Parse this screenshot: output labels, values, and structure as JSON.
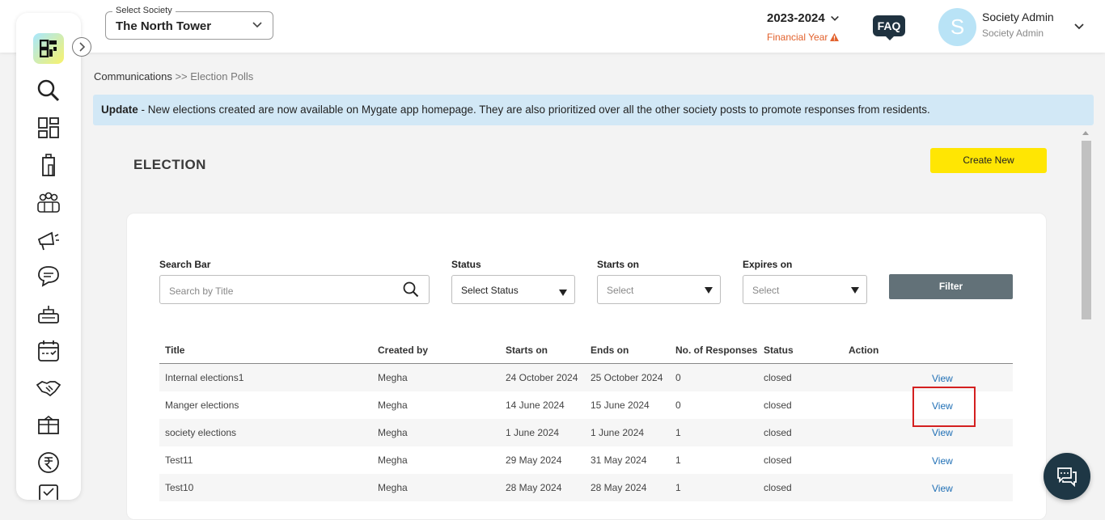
{
  "header": {
    "society_select_label": "Select Society",
    "society_value": "The North Tower",
    "financial_year": "2023-2024",
    "financial_year_label": "Financial Year",
    "faq_label": "FAQ",
    "avatar_initial": "S",
    "user_name": "Society Admin",
    "user_role": "Society Admin"
  },
  "sidebar": {
    "items": [
      "search-icon",
      "dashboard-icon",
      "building-icon",
      "residents-icon",
      "notices-icon",
      "communications-icon",
      "amenities-icon",
      "calendar-icon",
      "helpdesk-icon",
      "parcel-icon",
      "accounts-icon",
      "checklist-icon"
    ],
    "active": "communications-icon"
  },
  "breadcrumb": {
    "parent": "Communications",
    "separator": ">>",
    "current": "Election Polls"
  },
  "banner": {
    "strong": "Update",
    "text": " - New elections created are now available on Mygate app homepage. They are also prioritized over all the other society posts to promote responses from residents."
  },
  "main": {
    "title": "ELECTION",
    "create_button": "Create New"
  },
  "filters": {
    "search_label": "Search Bar",
    "search_placeholder": "Search by Title",
    "status_label": "Status",
    "status_value": "Select Status",
    "starts_label": "Starts on",
    "starts_value": "Select",
    "expires_label": "Expires on",
    "expires_value": "Select",
    "filter_button": "Filter"
  },
  "table": {
    "headers": [
      "Title",
      "Created by",
      "Starts on",
      "Ends on",
      "No. of Responses",
      "Status",
      "Action"
    ],
    "rows": [
      {
        "title": "Internal elections1",
        "created_by": "Megha",
        "starts": "24 October 2024",
        "ends": "25 October 2024",
        "responses": "0",
        "status": "closed",
        "action": "View"
      },
      {
        "title": "Manger elections",
        "created_by": "Megha",
        "starts": "14 June 2024",
        "ends": "15 June 2024",
        "responses": "0",
        "status": "closed",
        "action": "View"
      },
      {
        "title": "society elections",
        "created_by": "Megha",
        "starts": "1 June 2024",
        "ends": "1 June 2024",
        "responses": "1",
        "status": "closed",
        "action": "View"
      },
      {
        "title": "Test11",
        "created_by": "Megha",
        "starts": "29 May 2024",
        "ends": "31 May 2024",
        "responses": "1",
        "status": "closed",
        "action": "View"
      },
      {
        "title": "Test10",
        "created_by": "Megha",
        "starts": "28 May 2024",
        "ends": "28 May 2024",
        "responses": "1",
        "status": "closed",
        "action": "View"
      }
    ]
  },
  "colors": {
    "accent_yellow": "#ffe603",
    "banner_blue": "#d2e8f6",
    "link_blue": "#1f6fb5",
    "warning_orange": "#e2612c",
    "highlight_red": "#d42020"
  }
}
